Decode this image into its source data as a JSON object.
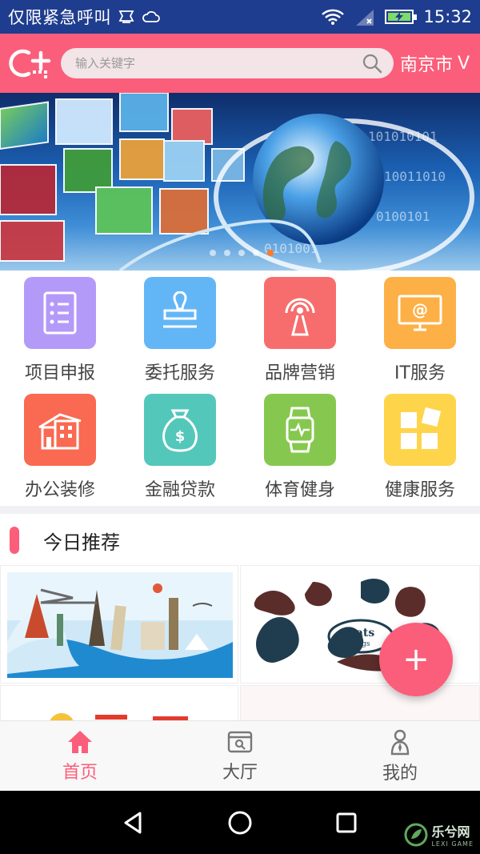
{
  "status_bar": {
    "alert_text": "仅限紧急呼叫",
    "time": "15:32",
    "icons": [
      "sim-icon",
      "weather-cloud-icon",
      "wifi-icon",
      "signal-icon",
      "battery-charging-icon"
    ]
  },
  "header": {
    "logo_icon": "c-plus-logo",
    "search_placeholder": "输入关键字",
    "city": "南京市",
    "city_chevron": "V",
    "accent_color": "#fb5e7a"
  },
  "banner": {
    "slide_count": 5,
    "active_index": 4
  },
  "categories": [
    {
      "label": "项目申报",
      "icon": "document-list-icon",
      "color": "#b49af8"
    },
    {
      "label": "委托服务",
      "icon": "stamp-icon",
      "color": "#63b6f6"
    },
    {
      "label": "品牌营销",
      "icon": "broadcast-tower-icon",
      "color": "#f76d6d"
    },
    {
      "label": "IT服务",
      "icon": "monitor-at-icon",
      "color": "#fdb046"
    },
    {
      "label": "办公装修",
      "icon": "building-icon",
      "color": "#fa6951"
    },
    {
      "label": "金融贷款",
      "icon": "money-bag-icon",
      "color": "#54c7bb"
    },
    {
      "label": "体育健身",
      "icon": "smartwatch-icon",
      "color": "#86c84f"
    },
    {
      "label": "健康服务",
      "icon": "blocks-icon",
      "color": "#fed44b"
    }
  ],
  "recommend": {
    "title": "今日推荐",
    "card2_text_line1": "Cats",
    "card2_text_line2": "Dogs",
    "fab_label": "+"
  },
  "tabs": [
    {
      "label": "首页",
      "icon": "home-icon",
      "active": true
    },
    {
      "label": "大厅",
      "icon": "store-icon",
      "active": false
    },
    {
      "label": "我的",
      "icon": "person-icon",
      "active": false
    }
  ],
  "watermark": {
    "name": "乐兮网",
    "sub": "LEXI GAME"
  }
}
